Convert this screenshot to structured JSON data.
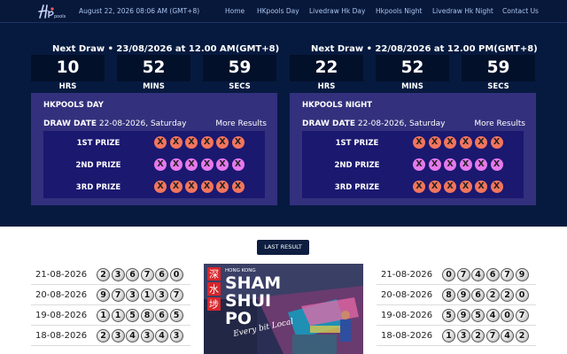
{
  "header": {
    "datetime": "August 22, 2026 08:06 AM (GMT+8)",
    "nav": [
      "Home",
      "HKpools Day",
      "Livedraw Hk Day",
      "Hkpools Night",
      "Livedraw Hk Night",
      "Contact Us"
    ],
    "logo_text": "pools"
  },
  "draws": [
    {
      "next_draw": "Next Draw • 23/08/2026 at 12.00 AM(GMT+8)",
      "countdown": [
        {
          "value": "10",
          "label": "HRS"
        },
        {
          "value": "52",
          "label": "MINS"
        },
        {
          "value": "59",
          "label": "SECS"
        }
      ],
      "title": "HKPOOLS DAY",
      "draw_date_label": "DRAW DATE",
      "draw_date_value": "22-08-2026, Saturday",
      "more_results": "More Results",
      "prizes": [
        {
          "label": "1ST PRIZE",
          "balls": [
            "X",
            "X",
            "X",
            "X",
            "X",
            "X"
          ],
          "color": "#f2755d"
        },
        {
          "label": "2ND PRIZE",
          "balls": [
            "X",
            "X",
            "X",
            "X",
            "X",
            "X"
          ],
          "color": "#e679ec"
        },
        {
          "label": "3RD PRIZE",
          "balls": [
            "X",
            "X",
            "X",
            "X",
            "X",
            "X"
          ],
          "color": "#f2755d"
        }
      ]
    },
    {
      "next_draw": "Next Draw • 22/08/2026 at 12.00 PM(GMT+8)",
      "countdown": [
        {
          "value": "22",
          "label": "HRS"
        },
        {
          "value": "52",
          "label": "MINS"
        },
        {
          "value": "59",
          "label": "SECS"
        }
      ],
      "title": "HKPOOLS NIGHT",
      "draw_date_label": "DRAW DATE",
      "draw_date_value": "22-08-2026, Saturday",
      "more_results": "More Results",
      "prizes": [
        {
          "label": "1ST PRIZE",
          "balls": [
            "X",
            "X",
            "X",
            "X",
            "X",
            "X"
          ],
          "color": "#f2755d"
        },
        {
          "label": "2ND PRIZE",
          "balls": [
            "X",
            "X",
            "X",
            "X",
            "X",
            "X"
          ],
          "color": "#e679ec"
        },
        {
          "label": "3RD PRIZE",
          "balls": [
            "X",
            "X",
            "X",
            "X",
            "X",
            "X"
          ],
          "color": "#f2755d"
        }
      ]
    }
  ],
  "last_result_button": "LAST RESULT",
  "results_left": [
    {
      "date": "21-08-2026",
      "digits": [
        "2",
        "3",
        "6",
        "7",
        "6",
        "0"
      ]
    },
    {
      "date": "20-08-2026",
      "digits": [
        "9",
        "7",
        "3",
        "1",
        "3",
        "7"
      ]
    },
    {
      "date": "19-08-2026",
      "digits": [
        "1",
        "1",
        "5",
        "8",
        "6",
        "5"
      ]
    },
    {
      "date": "18-08-2026",
      "digits": [
        "2",
        "3",
        "4",
        "3",
        "4",
        "3"
      ]
    }
  ],
  "results_right": [
    {
      "date": "21-08-2026",
      "digits": [
        "0",
        "7",
        "4",
        "6",
        "7",
        "9"
      ]
    },
    {
      "date": "20-08-2026",
      "digits": [
        "8",
        "9",
        "6",
        "2",
        "2",
        "0"
      ]
    },
    {
      "date": "19-08-2026",
      "digits": [
        "5",
        "9",
        "5",
        "4",
        "0",
        "7"
      ]
    },
    {
      "date": "18-08-2026",
      "digits": [
        "1",
        "3",
        "2",
        "7",
        "4",
        "2"
      ]
    }
  ],
  "ad": {
    "subtitle": "HONG KONG",
    "chinese": [
      "深",
      "水",
      "埗"
    ],
    "line1": "SHAM",
    "line2": "SHUI",
    "line3": "PO",
    "tagline": "Every bit Local"
  }
}
